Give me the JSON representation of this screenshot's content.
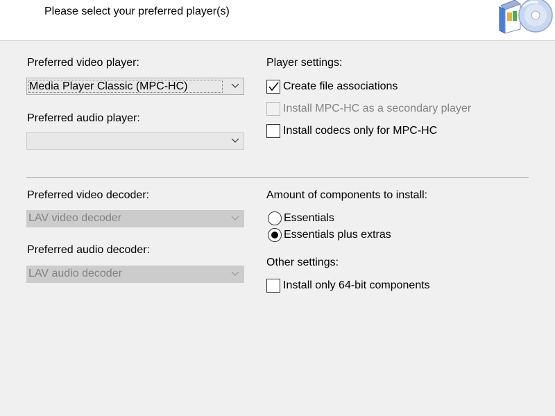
{
  "header": {
    "title": "Please select your preferred player(s)",
    "logo_icon": "software-box-cd-icon"
  },
  "players": {
    "video_label": "Preferred video player:",
    "video_value": "Media Player Classic (MPC-HC)",
    "audio_label": "Preferred audio player:",
    "audio_value": ""
  },
  "player_settings": {
    "heading": "Player settings:",
    "create_assoc": {
      "label": "Create file associations",
      "checked": true,
      "enabled": true
    },
    "secondary": {
      "label": "Install MPC-HC as a secondary player",
      "checked": false,
      "enabled": false
    },
    "codecs_only": {
      "label": "Install codecs only for MPC-HC",
      "checked": false,
      "enabled": true
    }
  },
  "decoders": {
    "video_label": "Preferred video decoder:",
    "video_value": "LAV video decoder",
    "audio_label": "Preferred audio decoder:",
    "audio_value": "LAV audio decoder"
  },
  "components": {
    "heading": "Amount of components to install:",
    "options": [
      "Essentials",
      "Essentials plus extras"
    ],
    "selected": "Essentials plus extras"
  },
  "other": {
    "heading": "Other settings:",
    "only64": {
      "label": "Install only 64-bit components",
      "checked": false
    }
  }
}
